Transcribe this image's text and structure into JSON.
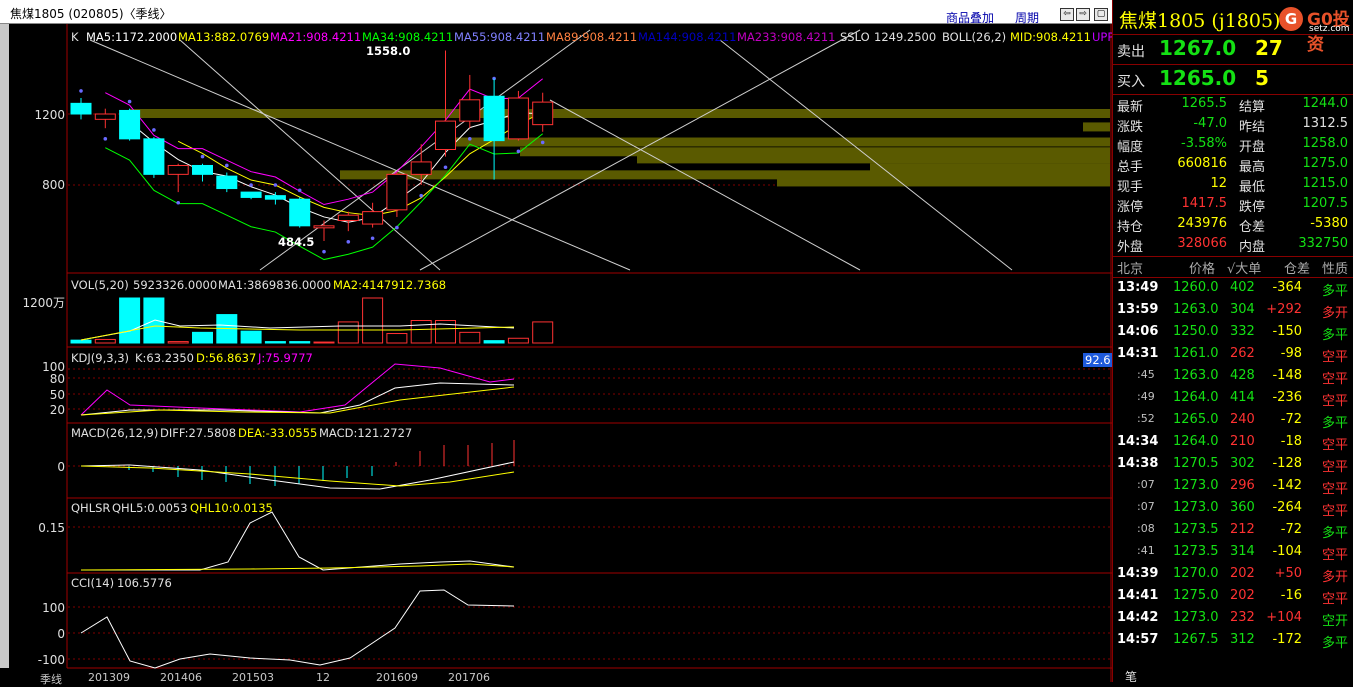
{
  "title": "焦煤1805 (020805)〈季线〉",
  "toolbar": {
    "overlay": "商品叠加",
    "period": "周期",
    "btn_back": "⇦",
    "btn_fwd": "⇨",
    "btn_grid": "▦",
    "btn_close": "▢"
  },
  "indicators": {
    "k": "K",
    "ma5": "MA5:1172.2000",
    "ma13": "MA13:882.0769",
    "ma21": "MA21:908.4211",
    "ma34": "MA34:908.4211",
    "ma55": "MA55:908.4211",
    "ma89": "MA89:908.4211",
    "ma144": "MA144:908.4211",
    "ma233": "MA233:908.4211",
    "sslo": "SSLO",
    "sslo_val": "1249.2500",
    "boll": "BOLL(26,2)",
    "mid": "MID:908.4211",
    "upp": "UPP",
    "vol": "VOL(5,20)",
    "vol_val": "5923326.0000",
    "vol_ma1": "MA1:3869836.0000",
    "vol_ma2": "MA2:4147912.7368",
    "kdj": "KDJ(9,3,3)",
    "kdj_k": "K:63.2350",
    "kdj_d": "D:56.8637",
    "kdj_j": "J:75.9777",
    "kdj_badge": "92.6",
    "macd": "MACD(26,12,9)",
    "macd_diff": "DIFF:27.5808",
    "macd_dea": "DEA:-33.0555",
    "macd_val": "MACD:121.2727",
    "qhlsr": "QHLSR",
    "qhl5": "QHL5:0.0053",
    "qhl10": "QHL10:0.0135",
    "cci": "CCI(14)",
    "cci_val": "106.5776"
  },
  "annotations": {
    "high": "1558.0",
    "low": "484.5"
  },
  "yaxis": {
    "price": [
      "1200",
      "800"
    ],
    "vol": [
      "1200万"
    ],
    "kdj": [
      "100",
      "80",
      "50",
      "20"
    ],
    "macd": [
      "0"
    ],
    "qhl": [
      "0.15"
    ],
    "cci": [
      "100",
      "0",
      "-100"
    ]
  },
  "xaxis": {
    "label": "季线",
    "ticks": [
      "201309",
      "201406",
      "201503",
      "12",
      "201609",
      "201706"
    ]
  },
  "candles": [
    {
      "o": 1260,
      "c": 1200,
      "h": 1290,
      "l": 1170,
      "up": false
    },
    {
      "o": 1170,
      "c": 1200,
      "h": 1230,
      "l": 1120,
      "up": true
    },
    {
      "o": 1220,
      "c": 1060,
      "h": 1230,
      "l": 1050,
      "up": false
    },
    {
      "o": 1060,
      "c": 860,
      "h": 1070,
      "l": 840,
      "up": false
    },
    {
      "o": 860,
      "c": 910,
      "h": 920,
      "l": 760,
      "up": true
    },
    {
      "o": 910,
      "c": 860,
      "h": 920,
      "l": 820,
      "up": false
    },
    {
      "o": 850,
      "c": 780,
      "h": 870,
      "l": 760,
      "up": false
    },
    {
      "o": 760,
      "c": 730,
      "h": 760,
      "l": 720,
      "up": false
    },
    {
      "o": 740,
      "c": 720,
      "h": 760,
      "l": 690,
      "up": false
    },
    {
      "o": 720,
      "c": 570,
      "h": 730,
      "l": 560,
      "up": false
    },
    {
      "o": 560,
      "c": 570,
      "h": 600,
      "l": 484.5,
      "up": true
    },
    {
      "o": 600,
      "c": 630,
      "h": 650,
      "l": 540,
      "up": true
    },
    {
      "o": 580,
      "c": 650,
      "h": 700,
      "l": 560,
      "up": true
    },
    {
      "o": 660,
      "c": 860,
      "h": 870,
      "l": 620,
      "up": true
    },
    {
      "o": 860,
      "c": 930,
      "h": 1030,
      "l": 800,
      "up": true
    },
    {
      "o": 1000,
      "c": 1160,
      "h": 1558,
      "l": 960,
      "up": true
    },
    {
      "o": 1160,
      "c": 1280,
      "h": 1420,
      "l": 1120,
      "up": true
    },
    {
      "o": 1300,
      "c": 1050,
      "h": 1400,
      "l": 830,
      "up": false
    },
    {
      "o": 1060,
      "c": 1290,
      "h": 1330,
      "l": 1050,
      "up": true
    },
    {
      "o": 1140,
      "c": 1267,
      "h": 1320,
      "l": 1100,
      "up": true
    }
  ],
  "quote": {
    "name": "焦煤1805 (j1805)",
    "logo": "G",
    "site": "G0投资",
    "domain": "setz.com",
    "sell_label": "卖出",
    "sell_price": "1267.0",
    "sell_qty": "27",
    "buy_label": "买入",
    "buy_price": "1265.0",
    "buy_qty": "5",
    "stats": [
      [
        "最新",
        "1265.5",
        "g",
        "结算",
        "1244.0",
        "g"
      ],
      [
        "涨跌",
        "-47.0",
        "g",
        "昨结",
        "1312.5",
        "w"
      ],
      [
        "幅度",
        "-3.58%",
        "g",
        "开盘",
        "1258.0",
        "g"
      ],
      [
        "总手",
        "660816",
        "y",
        "最高",
        "1275.0",
        "g"
      ],
      [
        "现手",
        "12",
        "y",
        "最低",
        "1215.0",
        "g"
      ],
      [
        "涨停",
        "1417.5",
        "r",
        "跌停",
        "1207.5",
        "g"
      ],
      [
        "持仓",
        "243976",
        "y",
        "仓差",
        "-5380",
        "y"
      ],
      [
        "外盘",
        "328066",
        "r",
        "内盘",
        "332750",
        "g"
      ]
    ],
    "tick_header": [
      "北京",
      "价格",
      "√大单",
      "仓差",
      "性质"
    ],
    "ticks": [
      [
        "13:49",
        "1260.0",
        "402",
        "-364",
        "多平",
        "g"
      ],
      [
        "13:59",
        "1263.0",
        "304",
        "+292",
        "多开",
        "r"
      ],
      [
        "14:06",
        "1250.0",
        "332",
        "-150",
        "多平",
        "g"
      ],
      [
        "14:31",
        "1261.0",
        "262",
        "-98",
        "空平",
        "r"
      ],
      [
        ":45",
        "1263.0",
        "428",
        "-148",
        "空平",
        "r"
      ],
      [
        ":49",
        "1264.0",
        "414",
        "-236",
        "空平",
        "r"
      ],
      [
        ":52",
        "1265.0",
        "240",
        "-72",
        "多平",
        "g"
      ],
      [
        "14:34",
        "1264.0",
        "210",
        "-18",
        "空平",
        "r"
      ],
      [
        "14:38",
        "1270.5",
        "302",
        "-128",
        "空平",
        "r"
      ],
      [
        ":07",
        "1273.0",
        "296",
        "-142",
        "空平",
        "r"
      ],
      [
        ":07",
        "1273.0",
        "360",
        "-264",
        "空平",
        "r"
      ],
      [
        ":08",
        "1273.5",
        "212",
        "-72",
        "多平",
        "g"
      ],
      [
        ":41",
        "1273.5",
        "314",
        "-104",
        "空平",
        "r"
      ],
      [
        "14:39",
        "1270.0",
        "202",
        "+50",
        "多开",
        "r"
      ],
      [
        "14:41",
        "1275.0",
        "202",
        "-16",
        "空平",
        "r"
      ],
      [
        "14:42",
        "1273.0",
        "232",
        "+104",
        "空开",
        "g"
      ],
      [
        "14:57",
        "1267.5",
        "312",
        "-172",
        "多平",
        "g"
      ]
    ],
    "bottom": "笔"
  },
  "colors": {
    "up": "#ff3232",
    "down": "#00ffff",
    "ma5": "#ffffff",
    "ma13": "#ffff00",
    "ma21": "#ff00ff",
    "ma34": "#00ff00",
    "ma55": "#8080ff",
    "ma89": "#ff8040",
    "ma144": "#0000c0",
    "ma233": "#c000c0",
    "boll": "#ffffff",
    "sslo": "#e0e0e0",
    "upp": "#c000ff",
    "zone": "#5a5a00",
    "grid": "#800000"
  }
}
